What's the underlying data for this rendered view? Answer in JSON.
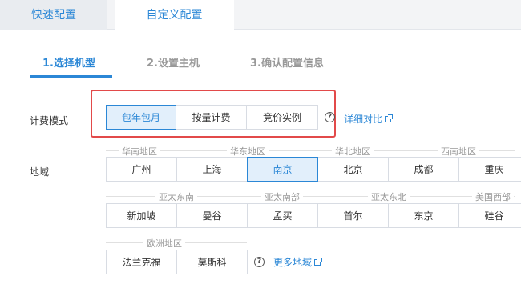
{
  "tabs": {
    "quick": "快速配置",
    "custom": "自定义配置"
  },
  "steps": [
    "1.选择机型",
    "2.设置主机",
    "3.确认配置信息"
  ],
  "billing": {
    "label": "计费模式",
    "options": [
      "包年包月",
      "按量计费",
      "竞价实例"
    ],
    "selected": "包年包月",
    "help": "?",
    "compare_link": "详细对比"
  },
  "region": {
    "label": "地域",
    "groups": [
      "华南地区",
      "华东地区",
      "华北地区",
      "西南地区",
      "亚太东南",
      "亚太南部",
      "亚太东北",
      "美国西部",
      "欧洲地区"
    ],
    "row1": [
      "广州",
      "上海",
      "南京",
      "北京",
      "成都",
      "重庆"
    ],
    "row2": [
      "新加坡",
      "曼谷",
      "孟买",
      "首尔",
      "东京",
      "硅谷"
    ],
    "row3": [
      "法兰克福",
      "莫斯科"
    ],
    "selected": "南京",
    "help": "?",
    "more_link": "更多地域"
  },
  "colors": {
    "accent": "#2b87d6",
    "highlight": "#e24a4a",
    "selected_bg": "#e2effb"
  }
}
